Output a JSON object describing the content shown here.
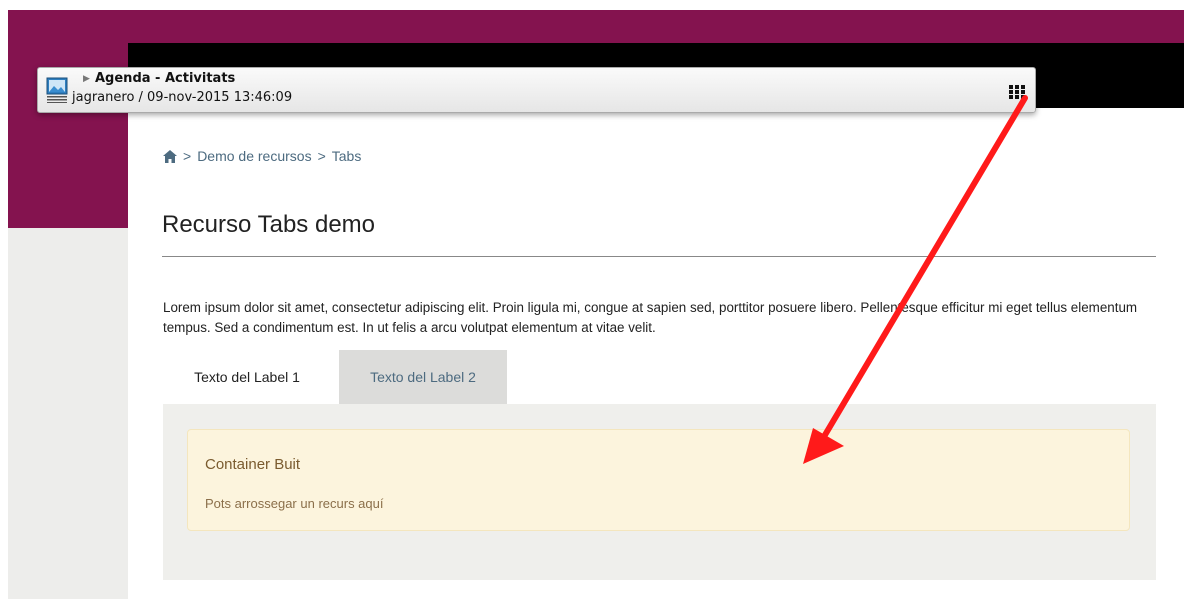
{
  "overlay": {
    "title": "Agenda - Activitats",
    "subtitle": "jagranero / 09-nov-2015 13:46:09"
  },
  "breadcrumb": {
    "items": [
      "Demo de recursos",
      "Tabs"
    ]
  },
  "page": {
    "title": "Recurso Tabs demo",
    "lead": "Lorem ipsum dolor sit amet, consectetur adipiscing elit. Proin ligula mi, congue at sapien sed, porttitor posuere libero. Pellentesque efficitur mi eget tellus elementum tempus. Sed a condimentum est. In ut felis a arcu volutpat elementum at vitae velit."
  },
  "tabs": [
    {
      "label": "Texto del Label 1",
      "active": true
    },
    {
      "label": "Texto del Label 2",
      "active": false
    }
  ],
  "container": {
    "title": "Container Buit",
    "text": "Pots arrossegar un recurs aquí"
  },
  "colors": {
    "brand": "#84134f",
    "arrow": "#ff1a1a"
  }
}
